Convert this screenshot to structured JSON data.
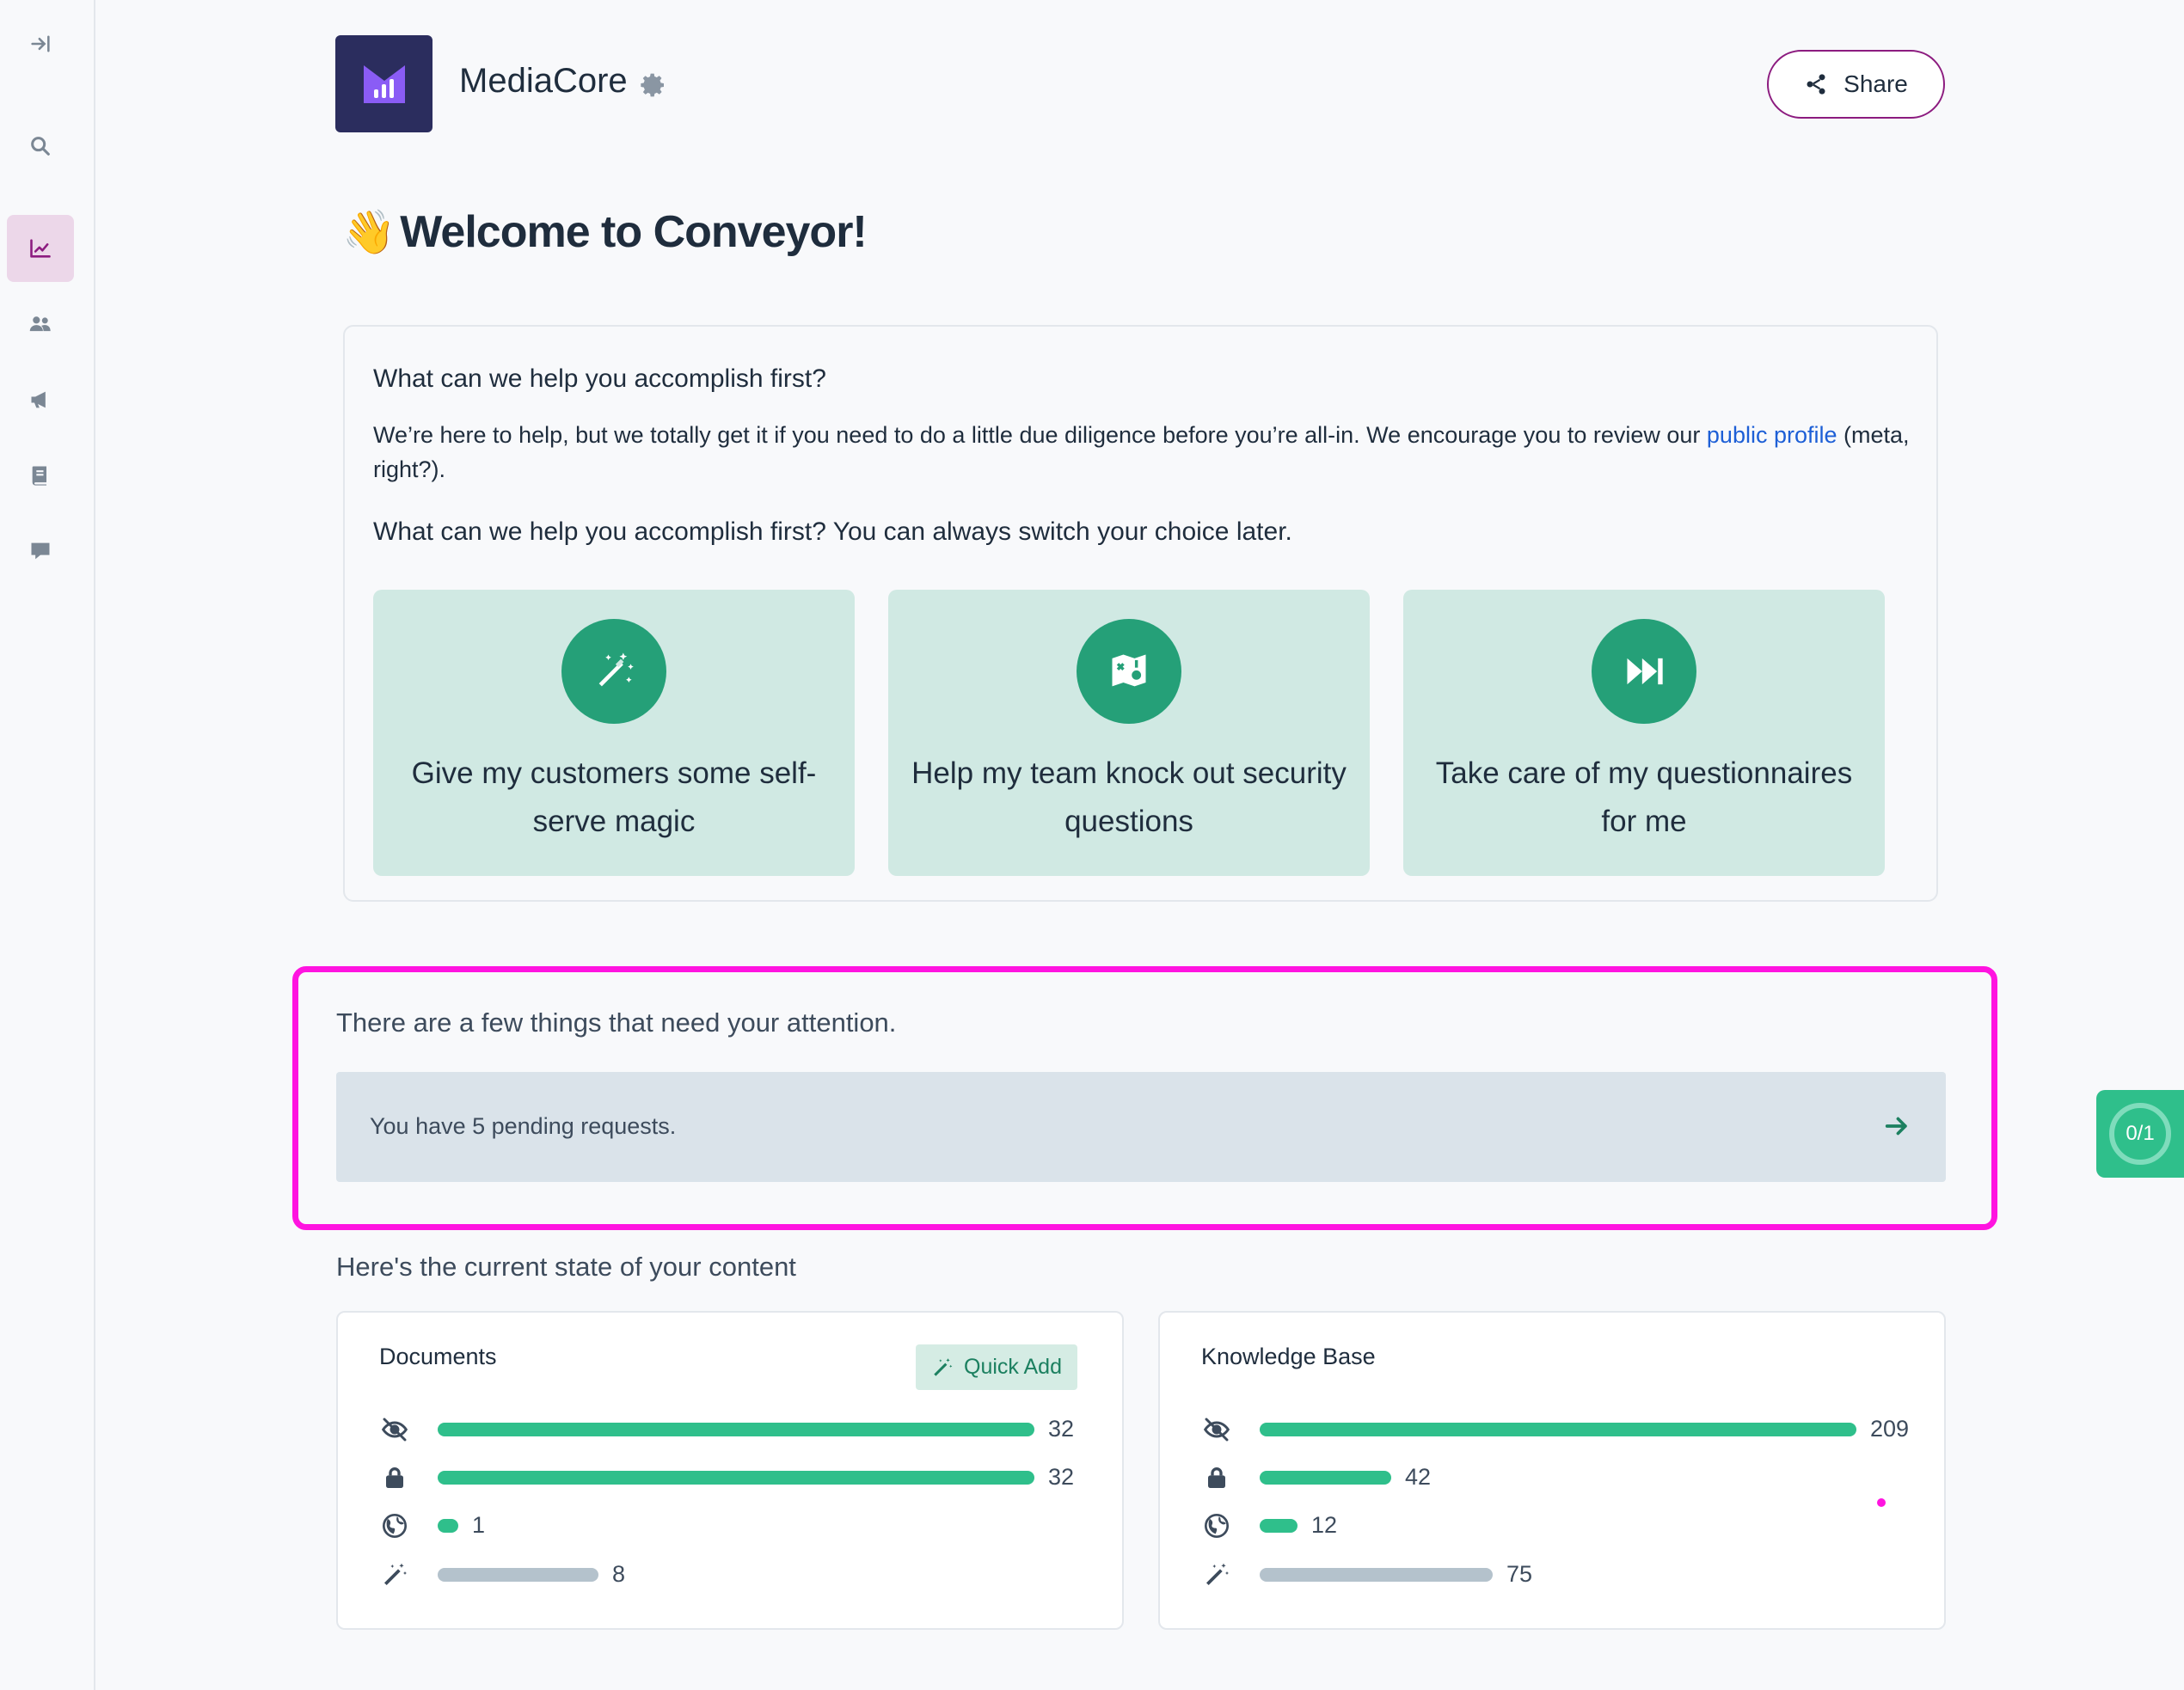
{
  "sidebar": {
    "items": [
      {
        "name": "collapse",
        "icon": "expand-sidebar-icon"
      },
      {
        "name": "search",
        "icon": "search-icon"
      },
      {
        "name": "analytics",
        "icon": "chart-icon",
        "active": true
      },
      {
        "name": "users",
        "icon": "users-icon"
      },
      {
        "name": "announcements",
        "icon": "megaphone-icon"
      },
      {
        "name": "library",
        "icon": "book-icon"
      },
      {
        "name": "messages",
        "icon": "chat-icon"
      }
    ]
  },
  "header": {
    "org_name": "MediaCore",
    "share_label": "Share"
  },
  "welcome": {
    "emoji": "👋",
    "title": "Welcome to Conveyor!"
  },
  "onboarding": {
    "heading": "What can we help you accomplish first?",
    "intro_before": "We’re here to help, but we totally get it if you need to do a little due diligence before you’re all-in. We encourage you to review our ",
    "intro_link": "public profile",
    "intro_after": " (meta, right?).",
    "prompt": "What can we help you accomplish first? You can always switch your choice later.",
    "choices": [
      {
        "label": "Give my customers some self-serve magic",
        "icon": "magic-wand-icon"
      },
      {
        "label": "Help my team knock out security questions",
        "icon": "questions-icon"
      },
      {
        "label": "Take care of my questionnaires for me",
        "icon": "fast-forward-icon"
      }
    ]
  },
  "attention": {
    "heading": "There are a few things that need your attention.",
    "pending_text": "You have 5 pending requests."
  },
  "progress_widget": {
    "label": "0/1"
  },
  "content": {
    "title": "Here's the current state of your content",
    "documents": {
      "title": "Documents",
      "quick_add_label": "Quick Add",
      "rows": [
        {
          "icon": "eye-slash-icon",
          "value": 32,
          "fraction": 1.0,
          "color": "green"
        },
        {
          "icon": "lock-icon",
          "value": 32,
          "fraction": 1.0,
          "color": "green"
        },
        {
          "icon": "globe-icon",
          "value": 1,
          "fraction": 0.035,
          "color": "green"
        },
        {
          "icon": "magic-wand-icon",
          "value": 8,
          "fraction": 0.27,
          "color": "gray"
        }
      ]
    },
    "knowledge_base": {
      "title": "Knowledge Base",
      "rows": [
        {
          "icon": "eye-slash-icon",
          "value": 209,
          "fraction": 1.0,
          "color": "green"
        },
        {
          "icon": "lock-icon",
          "value": 42,
          "fraction": 0.22,
          "color": "green"
        },
        {
          "icon": "globe-icon",
          "value": 12,
          "fraction": 0.063,
          "color": "green"
        },
        {
          "icon": "magic-wand-icon",
          "value": 75,
          "fraction": 0.39,
          "color": "gray"
        }
      ]
    }
  },
  "colors": {
    "accent_green": "#25a078",
    "bar_green": "#2fbf8b",
    "bar_gray": "#b4c2cc",
    "highlight_magenta": "#ff14e0",
    "brand_purple": "#8c1b7f"
  }
}
